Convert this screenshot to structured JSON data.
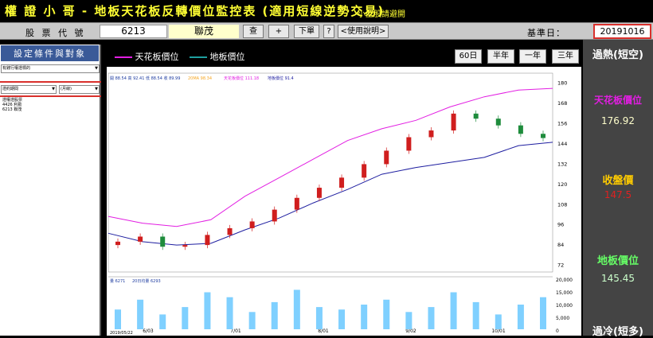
{
  "app": {
    "title": "權 證 小 哥 - 地板天花板反轉價位監控表 (適用短線逆勢交易)",
    "subtitle": "小型股請避開"
  },
  "toolbar": {
    "code_label": "股 票 代 號",
    "code_value": "6213",
    "name_value": "聯茂",
    "query": "查",
    "plus": "+",
    "next": "下單",
    "help_q": "?",
    "help": "<使用說明>",
    "base_label": "基準日：",
    "base_date": "20191016"
  },
  "sidebar": {
    "header": "設定條件與對象",
    "select1": "有錢行權證標的",
    "select2": "證約期間",
    "select3": "(月線)",
    "stocks": [
      "證權證股票",
      "4426 利勤",
      "6213 聯茂"
    ]
  },
  "legend": {
    "ceiling": "天花板價位",
    "floor": "地板價位"
  },
  "ranges": [
    "60日",
    "半年",
    "一年",
    "三年"
  ],
  "info_line": {
    "text": "開 88.54 高 92.41 低 88.54 收 89.99",
    "ma": "20MA 98.34",
    "ceiling": "天花板價位 111.18",
    "floor": "地板價位 91.4"
  },
  "vol_info": {
    "vol": "量 6271",
    "vol_ma": "20日均量 6293"
  },
  "right": {
    "overheat": "過熱(短空)",
    "ceiling_label": "天花板價位",
    "ceiling_value": "176.92",
    "close_label": "收盤價",
    "close_value": "147.5",
    "floor_label": "地板價位",
    "floor_value": "145.45",
    "overcold": "過冷(短多)"
  },
  "colors": {
    "ceiling": "#e21ee2",
    "floor": "#1e1ea0",
    "ma": "#f5a623",
    "up": "#d01e1e",
    "down": "#1e8c3c",
    "vol": "#7fd0ff"
  },
  "chart_data": {
    "type": "line",
    "x_ticks": [
      "6/03",
      "7/01",
      "8/01",
      "9/02",
      "10/01"
    ],
    "y_ticks": [
      72,
      84,
      96,
      108,
      120,
      132,
      144,
      156,
      168,
      180
    ],
    "ylim": [
      68,
      186
    ],
    "vol_ticks": [
      "20,000",
      "15,000",
      "10,000",
      "5,000",
      "0"
    ],
    "vol_ylim": [
      0,
      20000
    ],
    "year_label": "2019",
    "start_date": "2019/05/22",
    "series": [
      {
        "name": "天花板價位",
        "values": [
          101,
          97,
          95,
          99,
          113,
          124,
          135,
          146,
          153,
          158,
          166,
          172,
          176,
          177
        ]
      },
      {
        "name": "地板價位",
        "values": [
          91,
          86,
          84,
          85,
          93,
          100,
          109,
          117,
          126,
          130,
          133,
          136,
          143,
          145
        ]
      }
    ],
    "close": [
      86,
      89,
      83,
      84,
      90,
      94,
      98,
      105,
      112,
      118,
      124,
      132,
      140,
      148,
      152,
      162,
      159,
      155,
      150,
      147.5
    ],
    "volume": [
      8000,
      12000,
      6000,
      9000,
      15000,
      13000,
      7000,
      11000,
      16000,
      9000,
      8000,
      10000,
      12000,
      7000,
      9000,
      15000,
      11000,
      6000,
      10000,
      13000
    ]
  }
}
